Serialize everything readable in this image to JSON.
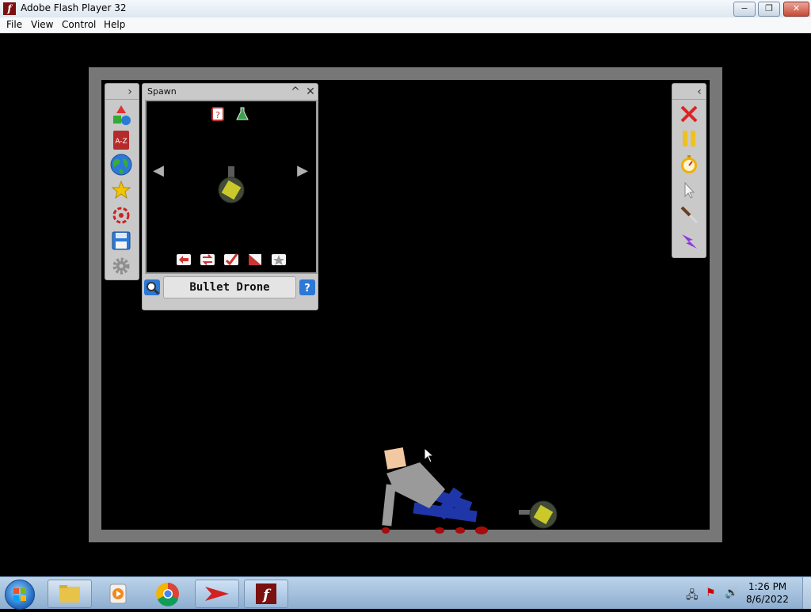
{
  "window": {
    "title": "Adobe Flash Player 32",
    "minimize": "−",
    "maximize": "❐",
    "close": "✕"
  },
  "menu": [
    "File",
    "View",
    "Control",
    "Help"
  ],
  "toolbar_left": {
    "expand": "›"
  },
  "spawn_panel": {
    "title": "Spawn",
    "collapse": "^",
    "close": "✕",
    "nav_prev": "◀",
    "nav_next": "▶",
    "search_value": "Bullet Drone"
  },
  "toolbar_right": {
    "collapse": "‹"
  },
  "taskbar": {
    "time": "1:26 PM",
    "date": "8/6/2022"
  }
}
